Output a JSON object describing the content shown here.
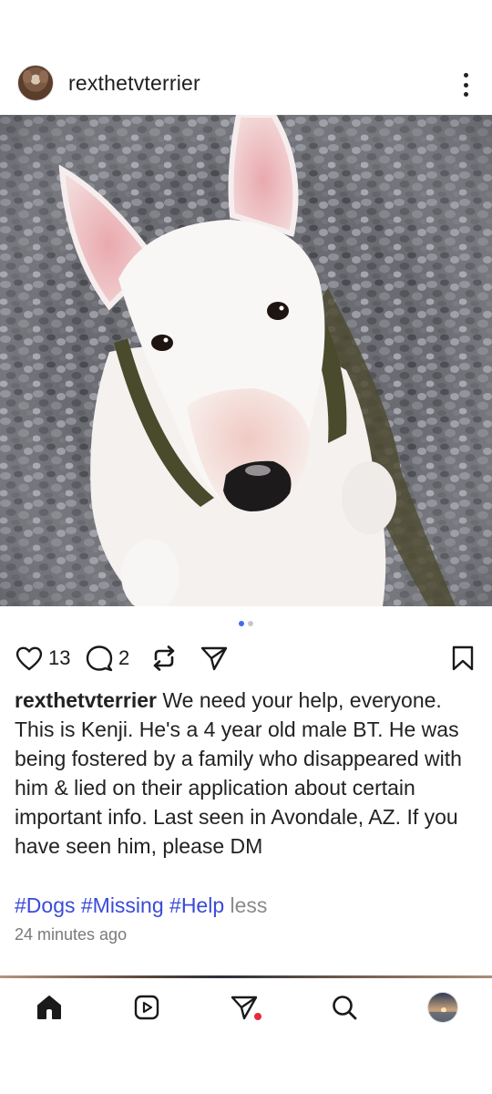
{
  "post": {
    "username": "rexthetvterrier",
    "likes": "13",
    "comments": "2",
    "caption_user": "rexthetvterrier",
    "caption_text": " We need your help, everyone.  This is Kenji.  He's a 4 year old male BT.  He was being fostered by a family who disappeared with him & lied on their application about certain important info.  Last seen in Avondale, AZ.  If you have seen him, please DM",
    "hashtags": [
      "#Dogs",
      "#Missing",
      "#Help"
    ],
    "less_label": "less",
    "timestamp": "24 minutes ago",
    "carousel_count": 2,
    "carousel_active": 1
  },
  "icons": {
    "like": "heart-icon",
    "comment": "comment-icon",
    "repost": "repost-icon",
    "share": "send-icon",
    "save": "bookmark-icon",
    "more": "more-vertical-icon"
  },
  "nav": {
    "items": [
      "home-icon",
      "reels-icon",
      "direct-messages-icon",
      "search-icon",
      "profile-avatar"
    ],
    "notification_color": "#e8283c"
  },
  "colors": {
    "hashtag": "#3a4bd8",
    "carousel_active": "#3b6cf6"
  }
}
